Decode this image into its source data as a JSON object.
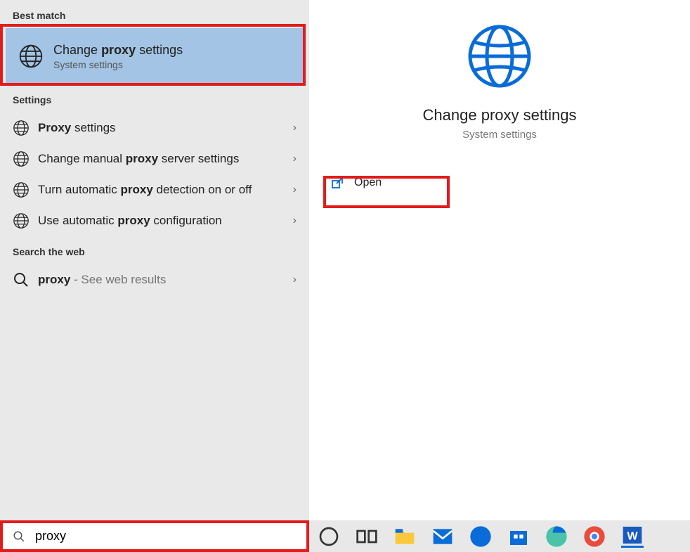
{
  "sections": {
    "best_match": "Best match",
    "settings": "Settings",
    "search_web": "Search the web"
  },
  "best_match_item": {
    "title_pre": "Change ",
    "title_strong": "proxy",
    "title_post": " settings",
    "subtitle": "System settings"
  },
  "settings_items": [
    {
      "pre": "",
      "strong": "Proxy",
      "post": " settings"
    },
    {
      "pre": "Change manual ",
      "strong": "proxy",
      "post": " server settings"
    },
    {
      "pre": "Turn automatic ",
      "strong": "proxy",
      "post": " detection on or off"
    },
    {
      "pre": "Use automatic ",
      "strong": "proxy",
      "post": " configuration"
    }
  ],
  "web_item": {
    "strong": "proxy",
    "suffix": " - See web results"
  },
  "preview": {
    "title": "Change proxy settings",
    "subtitle": "System settings",
    "open_label": "Open"
  },
  "search": {
    "value": "proxy"
  },
  "chevron": "›",
  "taskbar_items": [
    "cortana",
    "task-view",
    "file-explorer",
    "mail",
    "dell",
    "microsoft-store",
    "edge",
    "chrome",
    "word"
  ]
}
